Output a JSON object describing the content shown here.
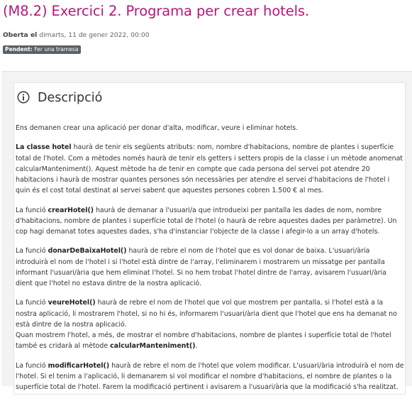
{
  "page": {
    "title": "(M8.2) Exercici 2. Programa per crear hotels.",
    "opened_label": "Oberta el",
    "opened_date": "dimarts, 11 de gener 2022, 00:00",
    "badge_label": "Pendent:",
    "badge_text": "Fer una tramesa"
  },
  "description": {
    "heading": "Descripció",
    "icon": "info-icon",
    "intro": "Ens demanen crear una aplicació per donar d'alta, modificar, veure i eliminar hotels.",
    "p1_bold": "La classe hotel",
    "p1_text": " haurà de tenir els següents atributs: nom, nombre d'habitacions, nombre de plantes i superfície total de l'hotel. Com a mètodes només haurà de tenir els getters i setters propis de la classe i un mètode anomenat calcularManteniment(). Aquest mètode ha de tenir en compte que cada persona del servei pot atendre 20 habitacions i haurà de mostrar quantes persones són necessàries per atendre el servei d'habitacions de l'hotel i quin és el cost total destinat al servei sabent que aquestes persones cobren 1.500 € al mes.",
    "p2_pre": "La funció ",
    "p2_bold": "crearHotel()",
    "p2_text": " haurà de demanar a l'usuari/a que introdueixi per pantalla les dades de nom, nombre d'habitacions, nombre de plantes i superfície total de l'hotel (o haurà de rebre aquestes dades per paràmetre). Un cop hagi demanat totes aquestes dades, s'ha d'instanciar l'objecte de la classe i afegir-lo a un array d'hotels.",
    "p3_pre": "La funció ",
    "p3_bold": "donarDeBaixaHotel()",
    "p3_text": " haurà de rebre el nom de l'hotel que es vol donar de baixa. L'usuari/ària introduirà el nom de l'hotel i si l'hotel està dintre de l'array, l'eliminarem i mostrarem un missatge per pantalla informant l'usuari/ària que hem eliminat l'hotel. Si no hem trobat l'hotel dintre de l'array, avisarem l'usuari/ària dient que l'hotel no estava dintre de la nostra aplicació.",
    "p4_pre": "La funció ",
    "p4_bold": "veureHotel()",
    "p4_text": " haurà de rebre el nom de l'hotel que vol que mostrem per pantalla, si l'hotel està a la nostra aplicació, li mostrarem l'hotel, si no hi és, informarem l'usuari/ària dient que l'hotel que ens ha demanat no està dintre de la nostra aplicació.",
    "p4_line2": "Quan mostrem l'hotel, a més, de mostrar el nombre d'habitacions, nombre de plantes i superfície total de l'hotel també es cridarà al mètode ",
    "p4_bold2": "calcularManteniment()",
    "p4_end": ".",
    "p5_pre": "La funció ",
    "p5_bold": "modificarHotel()",
    "p5_text": " haurà de rebre el nom de l'hotel que volem modificar. L'usuari/ària introduirà el nom de l'hotel. Si el tenim a l'aplicació, li demanarem si vol modificar el nombre d'habitacions, el nombre de plantes o la superfície total de l'hotel. Farem la modificació pertinent i avisarem a l'usuari/ària que la modificació s'ha realitzat."
  }
}
